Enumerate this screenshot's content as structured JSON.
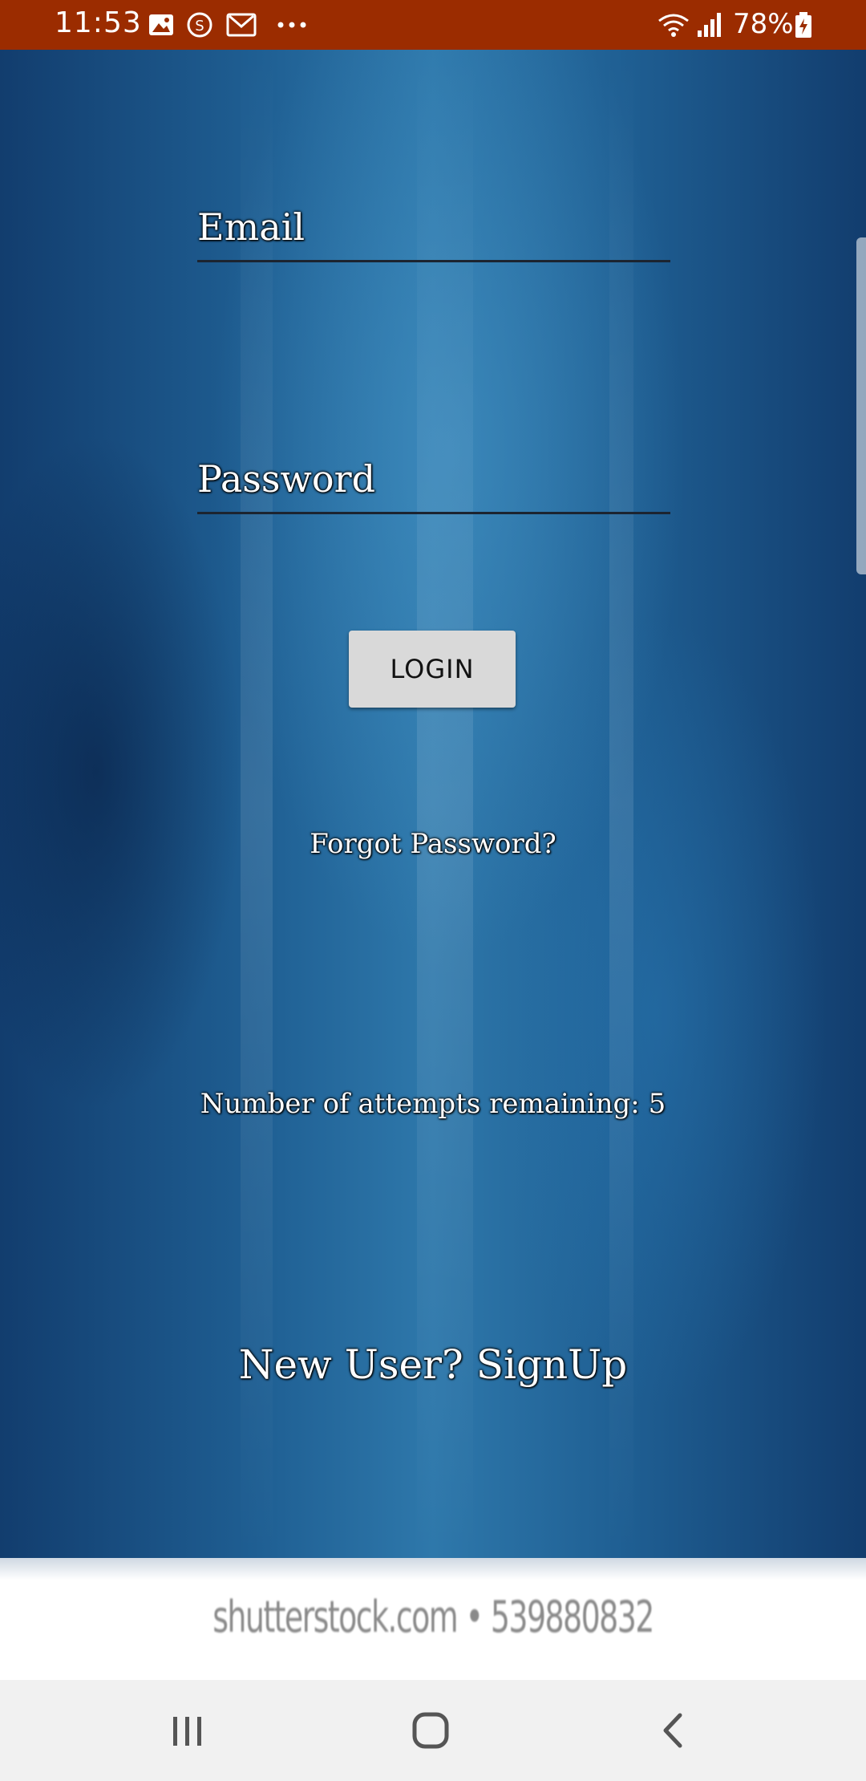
{
  "status_bar": {
    "time": "11:53",
    "battery": "78%",
    "icons": [
      "image-icon",
      "s-app-icon",
      "gmail-icon",
      "more-dots-icon",
      "wifi-icon",
      "signal-icon",
      "battery-charging-icon"
    ]
  },
  "form": {
    "email_placeholder": "Email",
    "password_placeholder": "Password",
    "login_label": "LOGIN",
    "forgot_password": "Forgot Password?",
    "attempts_text": "Number of attempts remaining: 5",
    "signup_text": "New User? SignUp"
  },
  "watermark": {
    "text": "shutterstock.com • 539880832"
  },
  "nav_bar": {
    "icons": [
      "recent-apps-icon",
      "home-icon",
      "back-icon"
    ]
  },
  "colors": {
    "status_bar": "#9b2c00",
    "background": "#1f5f93",
    "button": "#d9d9d9",
    "nav_bar": "#f1f1f1"
  }
}
